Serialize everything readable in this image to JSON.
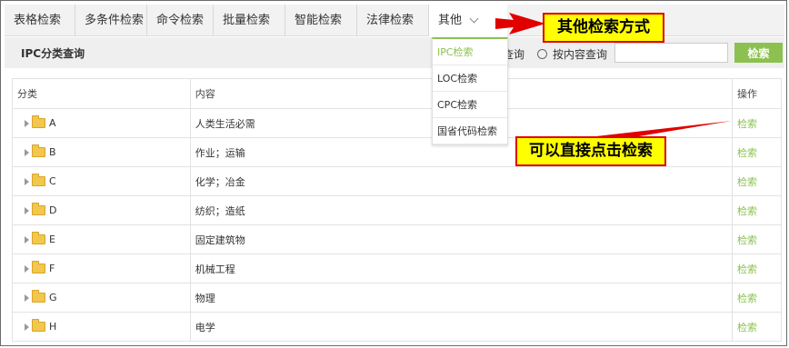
{
  "tabs": [
    {
      "label": "表格检索"
    },
    {
      "label": "多条件检索"
    },
    {
      "label": "命令检索"
    },
    {
      "label": "批量检索"
    },
    {
      "label": "智能检索"
    },
    {
      "label": "法律检索"
    }
  ],
  "more_tab": {
    "label": "其他",
    "icon": "chevron-down-icon"
  },
  "subbar": {
    "title": "IPC分类查询",
    "radio1_label": "查询",
    "radio2_label": "按内容查询",
    "search_value": "",
    "search_button": "检索"
  },
  "dropdown": [
    {
      "label": "IPC检索"
    },
    {
      "label": "LOC检索"
    },
    {
      "label": "CPC检索"
    },
    {
      "label": "国省代码检索"
    }
  ],
  "table": {
    "headers": [
      "分类",
      "内容",
      "操作"
    ],
    "rows": [
      {
        "code": "A",
        "content": "人类生活必需",
        "action": "检索"
      },
      {
        "code": "B",
        "content": "作业；运输",
        "action": "检索"
      },
      {
        "code": "C",
        "content": "化学；冶金",
        "action": "检索"
      },
      {
        "code": "D",
        "content": "纺织；造纸",
        "action": "检索"
      },
      {
        "code": "E",
        "content": "固定建筑物",
        "action": "检索"
      },
      {
        "code": "F",
        "content": "机械工程",
        "action": "检索"
      },
      {
        "code": "G",
        "content": "物理",
        "action": "检索"
      },
      {
        "code": "H",
        "content": "电学",
        "action": "检索"
      }
    ]
  },
  "annotations": {
    "callout1": "其他检索方式",
    "callout2": "可以直接点击检索"
  },
  "colors": {
    "accent": "#8cc152",
    "callout_bg": "#ffff00",
    "callout_border": "#e00000"
  }
}
